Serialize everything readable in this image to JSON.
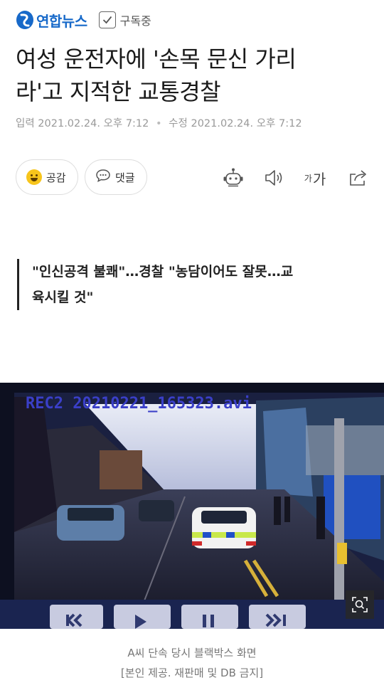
{
  "header": {
    "logo_text": "연합뉴스",
    "logo_icon": "yonhap-logo-icon",
    "subscribe_icon": "check-icon",
    "subscribe_label": "구독중"
  },
  "article": {
    "title_line1": "여성 운전자에 '손목 문신 가리",
    "title_line2": "라'고 지적한 교통경찰",
    "input_label": "입력",
    "input_time": "2021.02.24. 오후 7:12",
    "separator": "•",
    "modified_label": "수정",
    "modified_time": "2021.02.24. 오후 7:12",
    "subheadline_line1": "\"인신공격 불쾌\"…경찰 \"농담이어도 잘못…교",
    "subheadline_line2": "육시킬 것\""
  },
  "actions": {
    "reaction_label": "공감",
    "comment_label": "댓글",
    "icons": [
      "smile-emoji-icon",
      "speech-bubble-icon",
      "robot-summary-icon",
      "speaker-icon",
      "font-size-icon",
      "share-icon"
    ],
    "font_small": "가",
    "font_big": "가"
  },
  "photo": {
    "overlay_text": "REC2 20210221_165323.avi",
    "zoom_icon": "zoom-expand-icon",
    "caption_line1": "A씨 단속 당시 블랙박스 화면",
    "caption_line2": "[본인 제공. 재판매 및 DB 금지]"
  },
  "colors": {
    "brand_blue": "#1769c9",
    "emoji_yellow": "#f7c51c",
    "meta_gray": "#999999"
  }
}
